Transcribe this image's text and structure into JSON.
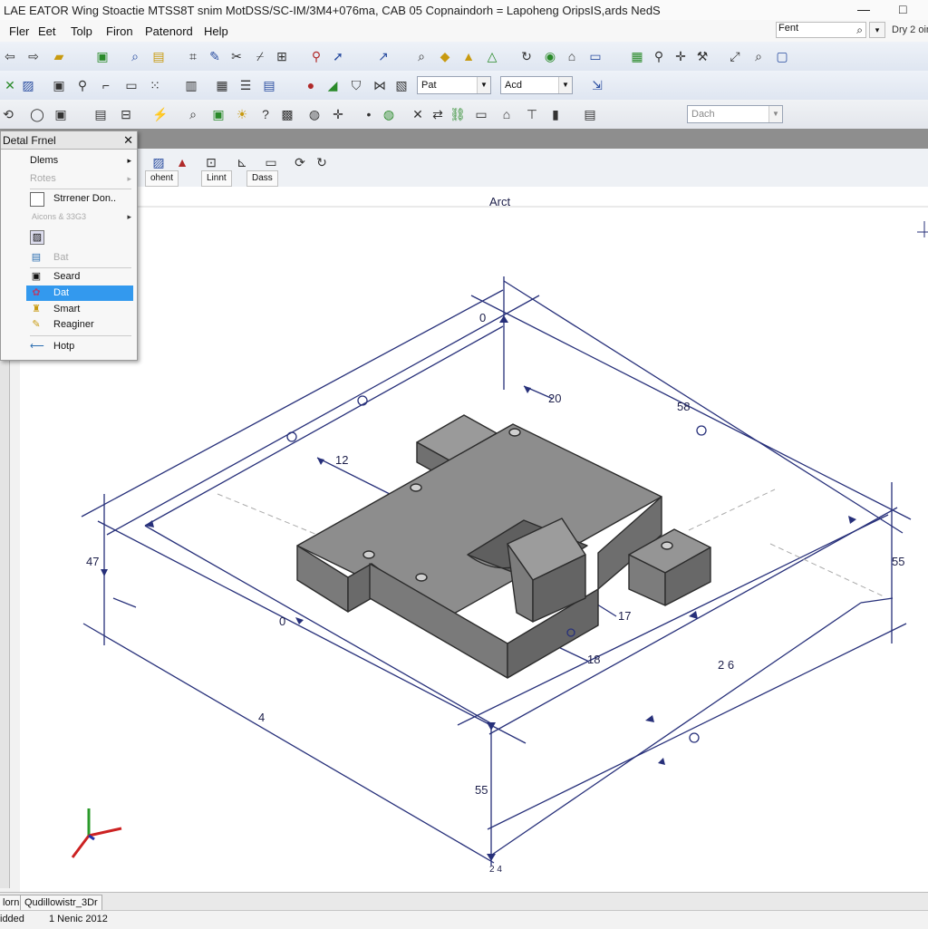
{
  "title": {
    "text": "LAE EATOR Wing Stoactie MTSS8T snim MotDSS/SC-IM/3M4+076ma, CAB 05 Copnaindorh = Lapoheng OripsIS,ards NedS"
  },
  "window_controls": {
    "minimize": "—",
    "maximize": "□"
  },
  "menu": {
    "items": [
      "Fler",
      "Eet",
      "Tolp",
      "Firon",
      "Patenord",
      "Help"
    ],
    "search": "Fent",
    "search_dropdown": "▾",
    "right_text": "Dry 2 oin"
  },
  "toolbar1": {
    "icons": [
      "back-arrow",
      "forward-arrow",
      "open-folder",
      "save",
      "zoom",
      "note",
      "measure",
      "pencil",
      "cut",
      "draw",
      "grid",
      "link",
      "arrow",
      "zoom-search",
      "measure-tape",
      "shape",
      "warning-triangle",
      "rotate",
      "globe",
      "home",
      "display",
      "layer",
      "route",
      "tool",
      "crosshair",
      "tool2",
      "zoom-in",
      "zoom-out",
      "window"
    ]
  },
  "toolbar2": {
    "combo1": "Pat",
    "combo2": "Acd"
  },
  "toolbar3": {
    "combo": "Dach"
  },
  "subtoolbar": {
    "tabs": [
      "ohent",
      "Linnt",
      "Dass"
    ]
  },
  "panel": {
    "title": "Detal Frnel",
    "items": [
      {
        "label": "Dlems",
        "has_sub": "▸"
      },
      {
        "label": "Rotes",
        "has_sub": "▸"
      },
      {
        "label": "Strrener Don.."
      },
      {
        "label": "Aicons & 33G3",
        "has_sub": "▸"
      },
      {
        "label": ""
      },
      {
        "label": "Bat"
      },
      {
        "label": "Seard"
      },
      {
        "label": "Dat"
      },
      {
        "label": "Smart"
      },
      {
        "label": "Reaginer"
      },
      {
        "label": "Hotp"
      }
    ]
  },
  "drawing": {
    "top_label": "Arct",
    "dims": [
      "0",
      "20",
      "58",
      "12",
      "47",
      "0",
      "55",
      "17",
      "18",
      "2 6",
      "4",
      "55"
    ],
    "bottom_mark": "2 4"
  },
  "bottom_tabs": [
    "lorn",
    "Qudillowistr_3Dr"
  ],
  "status": {
    "left": "idded",
    "date": "1  Nenic 2012"
  },
  "colors": {
    "dim_line": "#27307a",
    "part_top": "#8d8d8d",
    "part_side": "#6e6e6e",
    "part_front": "#787878",
    "selection": "#3399ee"
  }
}
